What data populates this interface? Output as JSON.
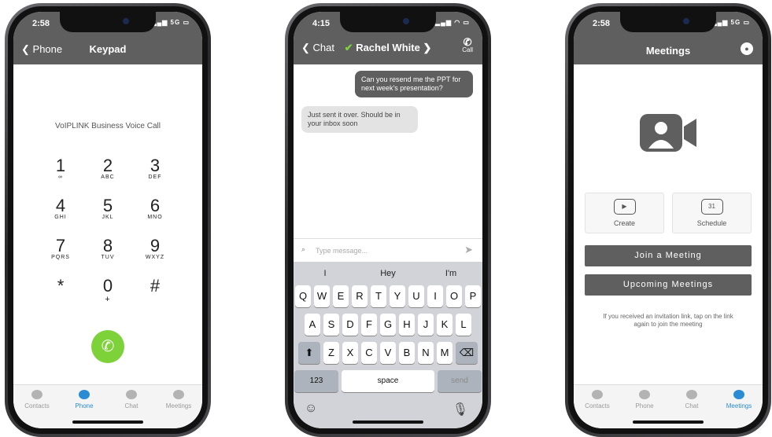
{
  "phone1": {
    "time": "2:58",
    "signal": "5G",
    "back_label": "Phone",
    "title": "Keypad",
    "subtitle": "VoIPLINK Business Voice Call",
    "keys": [
      {
        "digit": "1",
        "letters": "∞"
      },
      {
        "digit": "2",
        "letters": "ABC"
      },
      {
        "digit": "3",
        "letters": "DEF"
      },
      {
        "digit": "4",
        "letters": "GHI"
      },
      {
        "digit": "5",
        "letters": "JKL"
      },
      {
        "digit": "6",
        "letters": "MNO"
      },
      {
        "digit": "7",
        "letters": "PQRS"
      },
      {
        "digit": "8",
        "letters": "TUV"
      },
      {
        "digit": "9",
        "letters": "WXYZ"
      },
      {
        "digit": "*",
        "letters": ""
      },
      {
        "digit": "0",
        "letters": "+"
      },
      {
        "digit": "#",
        "letters": ""
      }
    ],
    "tabs": [
      "Contacts",
      "Phone",
      "Chat",
      "Meetings"
    ],
    "active_tab": "Phone"
  },
  "phone2": {
    "time": "4:15",
    "back_label": "Chat",
    "title": "Rachel White",
    "call_label": "Call",
    "msg_out": "Can you resend me the PPT for next week's presentation?",
    "msg_in": "Just sent it over. Should be in your inbox soon",
    "placeholder": "Type message...",
    "suggestions": [
      "I",
      "Hey",
      "I'm"
    ],
    "row1": [
      "Q",
      "W",
      "E",
      "R",
      "T",
      "Y",
      "U",
      "I",
      "O",
      "P"
    ],
    "row2": [
      "A",
      "S",
      "D",
      "F",
      "G",
      "H",
      "J",
      "K",
      "L"
    ],
    "row3": [
      "Z",
      "X",
      "C",
      "V",
      "B",
      "N",
      "M"
    ],
    "key_123": "123",
    "key_space": "space",
    "key_send": "send"
  },
  "phone3": {
    "time": "2:58",
    "signal": "5G",
    "title": "Meetings",
    "create_label": "Create",
    "schedule_label": "Schedule",
    "calendar_day": "31",
    "join_label": "Join a Meeting",
    "upcoming_label": "Upcoming Meetings",
    "note": "If you received an invitation link, tap on the link again to join the meeting",
    "tabs": [
      "Contacts",
      "Phone",
      "Chat",
      "Meetings"
    ],
    "active_tab": "Meetings"
  },
  "colors": {
    "nav": "#5f5f5f",
    "active": "#2a8cd3",
    "call": "#7dd23a"
  }
}
